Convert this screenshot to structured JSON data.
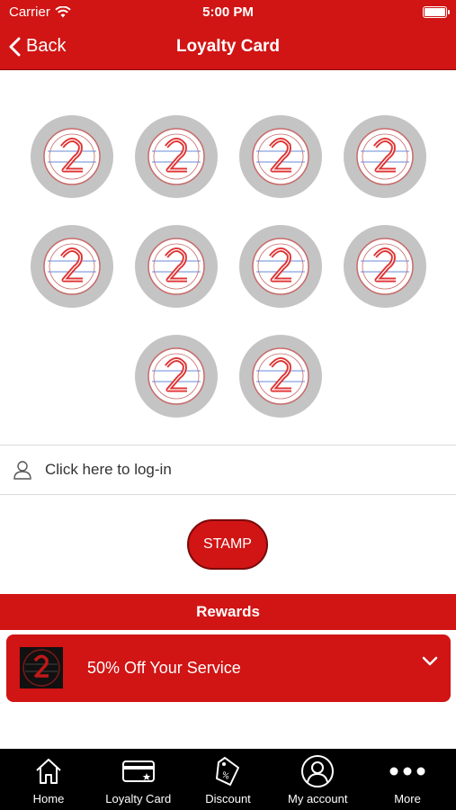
{
  "status_bar": {
    "carrier": "Carrier",
    "time": "5:00 PM"
  },
  "nav": {
    "back_label": "Back",
    "title": "Loyalty Card"
  },
  "stamp_card": {
    "slots": [
      {
        "icon": "stamp-logo-icon"
      },
      {
        "icon": "stamp-logo-icon"
      },
      {
        "icon": "stamp-logo-icon"
      },
      {
        "icon": "stamp-logo-icon"
      },
      {
        "icon": "stamp-logo-icon"
      },
      {
        "icon": "stamp-logo-icon"
      },
      {
        "icon": "stamp-logo-icon"
      },
      {
        "icon": "stamp-logo-icon"
      },
      {
        "icon": "stamp-logo-icon"
      },
      {
        "icon": "stamp-logo-icon"
      }
    ]
  },
  "login": {
    "label": "Click here to log-in",
    "icon": "user-icon"
  },
  "stamp_button": {
    "label": "STAMP"
  },
  "rewards": {
    "header": "Rewards",
    "items": [
      {
        "label": "50% Off Your Service",
        "icon": "chevron-down-icon"
      }
    ]
  },
  "tabs": [
    {
      "label": "Home",
      "icon": "home-icon"
    },
    {
      "label": "Loyalty Card",
      "icon": "loyalty-card-icon"
    },
    {
      "label": "Discount",
      "icon": "discount-tag-icon"
    },
    {
      "label": "My account",
      "icon": "account-icon"
    },
    {
      "label": "More",
      "icon": "more-icon"
    }
  ],
  "colors": {
    "brand_red": "#d11414",
    "stamp_gray": "#c4c4c4",
    "tabbar_bg": "#000000"
  }
}
